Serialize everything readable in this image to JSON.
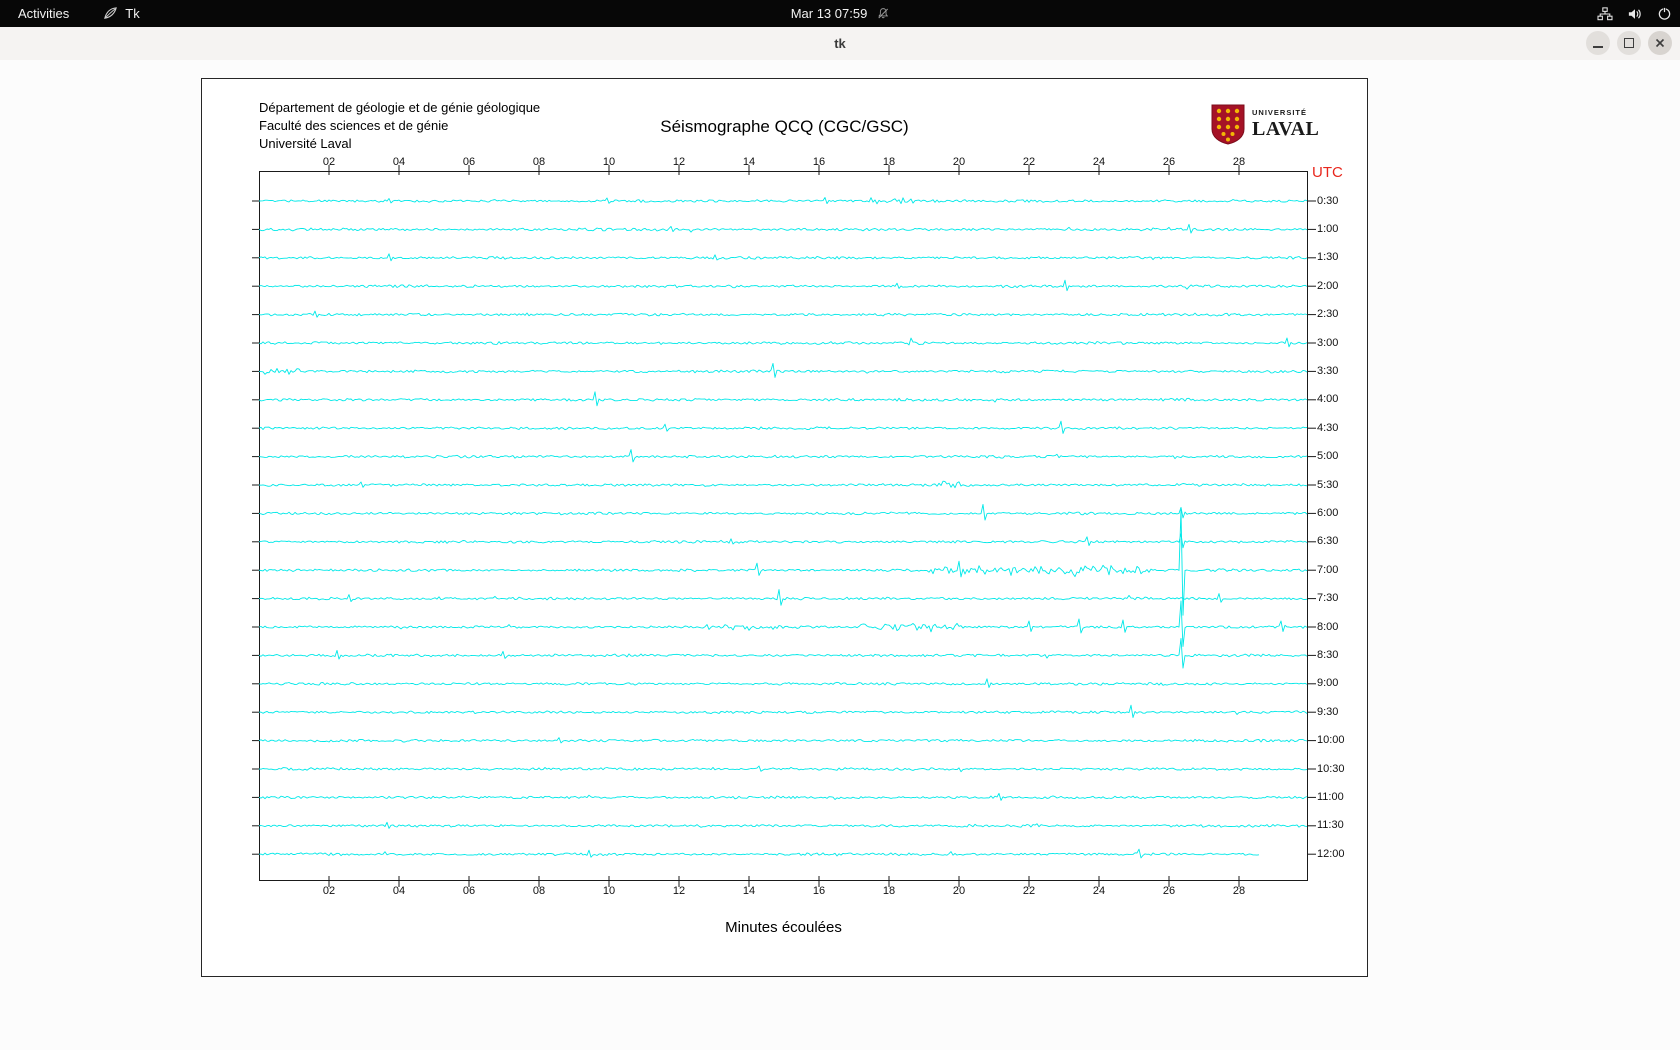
{
  "topbar": {
    "activities": "Activities",
    "app": "Tk",
    "clock": "Mar 13 07:59"
  },
  "window": {
    "title": "tk"
  },
  "header": {
    "dept_lines": [
      "Département de géologie et de génie géologique",
      "Faculté des sciences et de génie",
      "Université Laval"
    ],
    "title": "Séismographe QCQ (CGC/GSC)",
    "logo_top": "UNIVERSITÉ",
    "logo_bottom": "LAVAL"
  },
  "plot": {
    "utc_label": "UTC",
    "xlabel": "Minutes écoulées",
    "x_ticks": [
      "02",
      "04",
      "06",
      "08",
      "10",
      "12",
      "14",
      "16",
      "18",
      "20",
      "22",
      "24",
      "26",
      "28"
    ],
    "time_labels": [
      "0:30",
      "1:00",
      "1:30",
      "2:00",
      "2:30",
      "3:00",
      "3:30",
      "4:00",
      "4:30",
      "5:00",
      "5:30",
      "6:00",
      "6:30",
      "7:00",
      "7:30",
      "8:00",
      "8:30",
      "9:00",
      "9:30",
      "10:00",
      "10:30",
      "11:00",
      "11:30",
      "12:00"
    ]
  },
  "colors": {
    "trace": "#00e8e8",
    "utc": "#e8271d",
    "axis": "#1a1a1a"
  },
  "chart_data": {
    "type": "line",
    "title": "Séismographe QCQ (CGC/GSC)",
    "xlabel": "Minutes écoulées",
    "x_range_minutes": [
      0,
      30
    ],
    "x_ticks": [
      "02",
      "04",
      "06",
      "08",
      "10",
      "12",
      "14",
      "16",
      "18",
      "20",
      "22",
      "24",
      "26",
      "28"
    ],
    "trace_start_times_utc": [
      "0:30",
      "1:00",
      "1:30",
      "2:00",
      "2:30",
      "3:00",
      "3:30",
      "4:00",
      "4:30",
      "5:00",
      "5:30",
      "6:00",
      "6:30",
      "7:00",
      "7:30",
      "8:00",
      "8:30",
      "9:00",
      "9:30",
      "10:00",
      "10:30",
      "11:00",
      "11:30",
      "12:00"
    ],
    "description": "24 half-hour seismogram noise traces in cyan; strongest activity bursts on the 7:00 and 8:00 UTC traces with a large vertical spike near minute 26.4; final 12:00 trace ends near minute 28.6",
    "trace_color": "#00e8e8"
  }
}
